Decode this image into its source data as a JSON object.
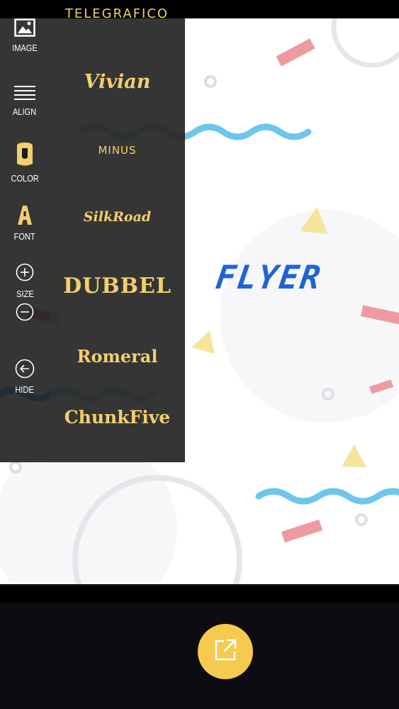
{
  "app": {
    "title": "TELEGRAFICO"
  },
  "toolbar": {
    "items": [
      {
        "label": "IMAGE",
        "icon": "image-icon"
      },
      {
        "label": "ALIGN",
        "icon": "align-icon"
      },
      {
        "label": "COLOR",
        "icon": "paint-bucket-icon"
      },
      {
        "label": "FONT",
        "icon": "font-icon"
      },
      {
        "label": "SIZE",
        "icon": "plus-minus-icon"
      },
      {
        "label": "HIDE",
        "icon": "arrow-left-icon"
      }
    ]
  },
  "fonts": {
    "options": [
      "Vivian",
      "MINUS",
      "SilkRoad",
      "DUBBEL",
      "Romeral",
      "ChunkFive"
    ]
  },
  "canvas": {
    "text": "FLYER",
    "text_color": "#1f63d6",
    "background": "#ffffff"
  },
  "colors": {
    "accent": "#f6c94f",
    "font_text": "#f4cf6e",
    "wave": "#6ec6ec",
    "rect": "#ef9aa1",
    "triangle": "#f3e69c"
  },
  "actions": {
    "share_icon": "share-external-icon"
  }
}
